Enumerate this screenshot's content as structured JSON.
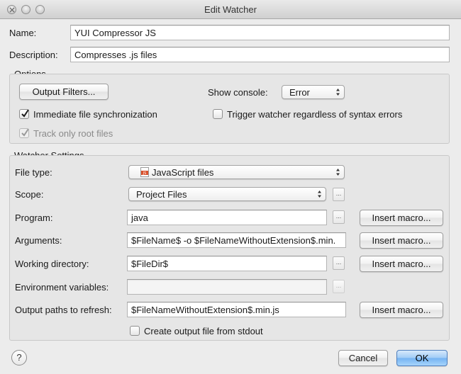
{
  "window": {
    "title": "Edit Watcher"
  },
  "name": {
    "label": "Name:",
    "value": "YUI Compressor JS"
  },
  "description": {
    "label": "Description:",
    "value": "Compresses .js files"
  },
  "options": {
    "title": "Options",
    "output_filters_label": "Output Filters...",
    "show_console_label": "Show console:",
    "show_console_value": "Error",
    "immediate_sync_label": "Immediate file synchronization",
    "immediate_sync_checked": true,
    "trigger_label": "Trigger watcher regardless of syntax errors",
    "trigger_checked": false,
    "track_root_label": "Track only root files",
    "track_root_checked": true
  },
  "settings": {
    "title": "Watcher Settings",
    "file_type_label": "File type:",
    "file_type_value": "JavaScript files",
    "file_type_icon": "js-file-icon",
    "scope_label": "Scope:",
    "scope_value": "Project Files",
    "program_label": "Program:",
    "program_value": "java",
    "arguments_label": "Arguments:",
    "arguments_value": "$FileName$ -o $FileNameWithoutExtension$.min.",
    "working_dir_label": "Working directory:",
    "working_dir_value": "$FileDir$",
    "env_label": "Environment variables:",
    "env_value": "",
    "output_paths_label": "Output paths to refresh:",
    "output_paths_value": "$FileNameWithoutExtension$.min.js",
    "insert_macro_label": "Insert macro...",
    "browse_label": "...",
    "stdout_label": "Create output file from stdout",
    "stdout_checked": false
  },
  "footer": {
    "help_label": "?",
    "cancel_label": "Cancel",
    "ok_label": "OK"
  },
  "colors": {
    "accent": "#74b3f2",
    "js_icon": "#d9512c"
  }
}
